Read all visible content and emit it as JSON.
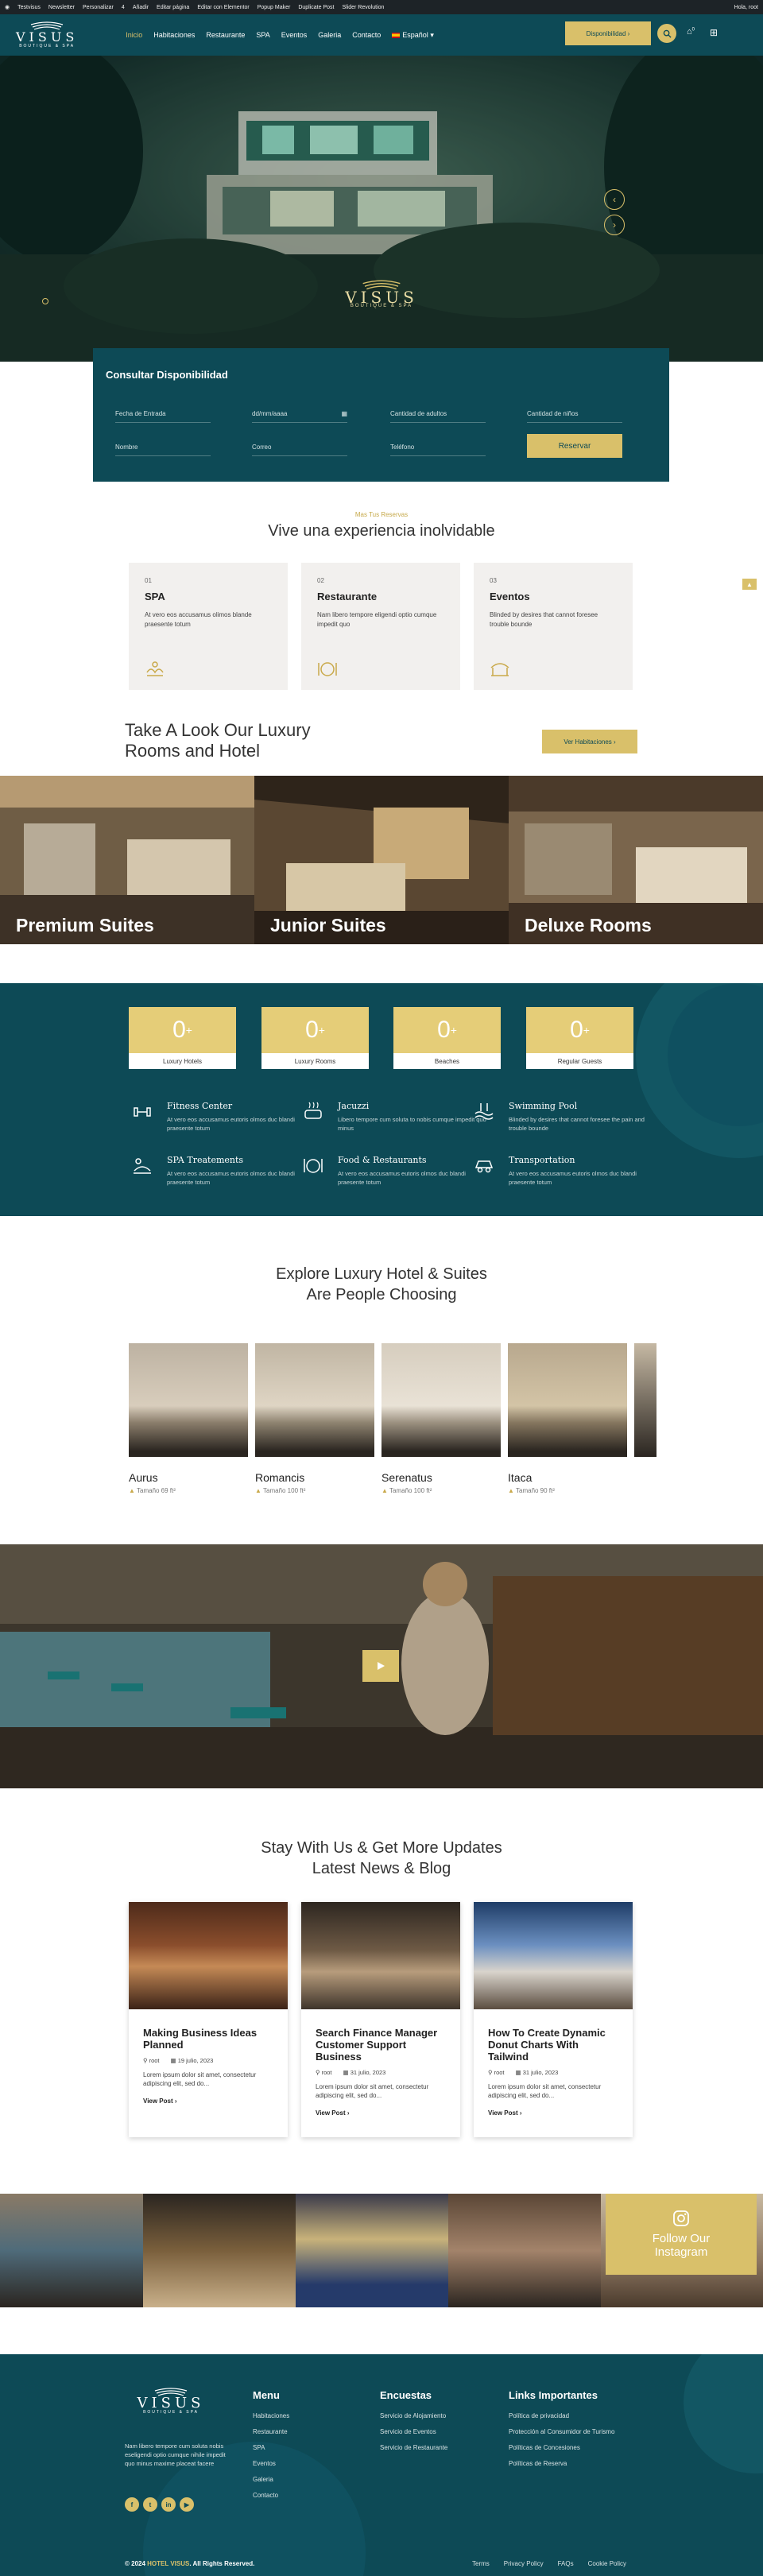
{
  "adminbar": {
    "items": [
      "Testvisus",
      "Newsletter",
      "Personalizar",
      "4",
      "Añadir",
      "Editar página",
      "Editar con Elementor",
      "Popup Maker",
      "Duplicate Post",
      "Slider Revolution"
    ],
    "greeting": "Hola, root"
  },
  "header": {
    "brand": "VISUS",
    "tagline": "BOUTIQUE & SPA",
    "nav": [
      "Inicio",
      "Habitaciones",
      "Restaurante",
      "SPA",
      "Eventos",
      "Galeria",
      "Contacto",
      "Español"
    ],
    "cta": "Disponibilidad",
    "cart_count": "0"
  },
  "hero": {
    "brand": "VISUS",
    "tagline": "BOUTIQUE & SPA"
  },
  "booking": {
    "title": "Consultar Disponibilidad",
    "fields": {
      "arrival": "Fecha de Entrada",
      "date_placeholder": "dd/mm/aaaa",
      "adults": "Cantidad de adultos",
      "children": "Cantidad de niños",
      "name": "Nombre",
      "email": "Correo",
      "phone": "Teléfono"
    },
    "submit": "Reservar"
  },
  "features": {
    "eyebrow": "Mas Tus Reservas",
    "title": "Vive una experiencia inolvidable",
    "cards": [
      {
        "num": "01",
        "title": "SPA",
        "desc": "At vero eos accusamus olimos blande praesente totum",
        "icon": "spa-icon"
      },
      {
        "num": "02",
        "title": "Restaurante",
        "desc": "Nam libero tempore eligendi optio cumque impedit quo",
        "icon": "dining-icon"
      },
      {
        "num": "03",
        "title": "Eventos",
        "desc": "Blinded by desires that cannot foresee trouble bounde",
        "icon": "events-icon"
      }
    ]
  },
  "rooms": {
    "title_line1": "Take A Look Our Luxury",
    "title_line2": "Rooms and Hotel",
    "button": "Ver Habitaciones",
    "items": [
      "Premium Suites",
      "Junior Suites",
      "Deluxe Rooms"
    ]
  },
  "stats": {
    "items": [
      {
        "value": "0",
        "label": "Luxury Hotels"
      },
      {
        "value": "0",
        "label": "Luxury Rooms"
      },
      {
        "value": "0",
        "label": "Beaches"
      },
      {
        "value": "0",
        "label": "Regular Guests"
      }
    ],
    "amenities": [
      {
        "title": "Fitness Center",
        "desc": "At vero eos accusamus eutoris olmos duc blandi praesente totum",
        "icon": "dumbbell-icon"
      },
      {
        "title": "Jacuzzi",
        "desc": "Libero tempore cum soluta to nobis cumque impedit quo minus",
        "icon": "jacuzzi-icon"
      },
      {
        "title": "Swimming Pool",
        "desc": "Blinded by desires that cannot foresee the pain and trouble bounde",
        "icon": "pool-icon"
      },
      {
        "title": "SPA Treatements",
        "desc": "At vero eos accusamus eutoris olmos duc blandi praesente totum",
        "icon": "spa-treatment-icon"
      },
      {
        "title": "Food & Restaurants",
        "desc": "At vero eos accusamus eutoris olmos duc blandi praesente totum",
        "icon": "food-icon"
      },
      {
        "title": "Transportation",
        "desc": "At vero eos accusamus eutoris olmos duc blandi praesente totum",
        "icon": "transport-icon"
      }
    ]
  },
  "explore": {
    "title_line1": "Explore Luxury Hotel & Suites",
    "title_line2": "Are People Choosing",
    "rooms": [
      {
        "name": "Aurus",
        "size": "Tamaño 69 ft²"
      },
      {
        "name": "Romancis",
        "size": "Tamaño 100 ft²"
      },
      {
        "name": "Serenatus",
        "size": "Tamaño 100 ft²"
      },
      {
        "name": "Itaca",
        "size": "Tamaño 90 ft²"
      }
    ]
  },
  "blog": {
    "title_line1": "Stay With Us & Get More Updates",
    "title_line2": "Latest News & Blog",
    "posts": [
      {
        "title": "Making Business Ideas Planned",
        "author": "root",
        "date": "19 julio, 2023",
        "excerpt": "Lorem ipsum dolor sit amet, consectetur adipiscing elit, sed do...",
        "more": "View Post"
      },
      {
        "title": "Search Finance Manager Customer Support Business",
        "author": "root",
        "date": "31 julio, 2023",
        "excerpt": "Lorem ipsum dolor sit amet, consectetur adipiscing elit, sed do...",
        "more": "View Post"
      },
      {
        "title": "How To Create Dynamic Donut Charts With Tailwind",
        "author": "root",
        "date": "31 julio, 2023",
        "excerpt": "Lorem ipsum dolor sit amet, consectetur adipiscing elit, sed do...",
        "more": "View Post"
      }
    ]
  },
  "instagram": {
    "label": "Follow Our Instagram"
  },
  "footer": {
    "brand": "VISUS",
    "tagline": "BOUTIQUE & SPA",
    "about": "Nam libero tempore cum soluta nobis eseligendi optio cumque nihile impedit quo minus maxime placeat facere",
    "menu_title": "Menu",
    "menu": [
      "Habitaciones",
      "Restaurante",
      "SPA",
      "Eventos",
      "Galeria",
      "Contacto"
    ],
    "surveys_title": "Encuestas",
    "surveys": [
      "Servicio de Alojamiento",
      "Servicio de Eventos",
      "Servicio de Restaurante"
    ],
    "links_title": "Links Importantes",
    "links": [
      "Política de privacidad",
      "Protección al Consumidor de Turismo",
      "Políticas de Concesiones",
      "Políticas de Reserva"
    ],
    "copyright_pre": "© 2024",
    "copyright_brand": "HOTEL VISUS",
    "copyright_post": "All Rights Reserved.",
    "legal": [
      "Terms",
      "Privacy Policy",
      "FAQs",
      "Cookie Policy"
    ]
  },
  "colors": {
    "teal": "#0d4a56",
    "gold": "#d9c06a"
  }
}
